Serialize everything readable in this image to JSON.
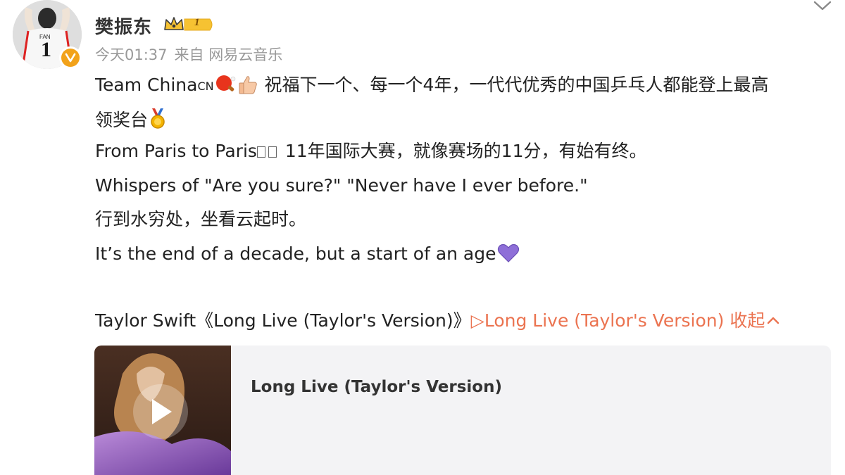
{
  "post": {
    "author": {
      "name": "樊振东",
      "jersey_text": "FAN",
      "jersey_number": "1",
      "vip_level": "1",
      "verified_icon": "verified-v-icon"
    },
    "time": "今天01:37",
    "source": "来自 网易云音乐",
    "lines": {
      "l1_prefix": "Team China",
      "l1_cn": "CN",
      "l1_text": "祝福下一个、每一个4年，一代代优秀的中国乒乓人都能登上最高",
      "l2_text": "领奖台",
      "l3_a": "From Paris to Paris",
      "l3_b": " 11年国际大赛，就像赛场的11分，有始有终。",
      "l4": "Whispers of \"Are you sure?\" \"Never have I ever before.\"",
      "l5": "行到水穷处，坐看云起时。",
      "l6": "It’s the end of a decade, but a start of an age"
    },
    "music": {
      "prefix": "Taylor Swift《Long Live (Taylor's Version)》",
      "link_text": "▷Long Live (Taylor's Version)",
      "collapse_text": "收起",
      "card_title": "Long Live (Taylor's Version)"
    }
  },
  "icons": {
    "ping_pong": "ping-pong-paddle-icon",
    "thumbs_up": "thumbs-up-icon",
    "medal": "gold-medal-icon",
    "heart": "purple-heart-icon",
    "play": "play-icon",
    "chevron_down": "chevron-down-icon",
    "chevron_up": "chevron-up-icon"
  },
  "colors": {
    "link": "#eb7350",
    "meta": "#999999",
    "card_bg": "#f3f3f5",
    "heart": "#8e6fd8",
    "badge_gold": "#f2a21a"
  }
}
